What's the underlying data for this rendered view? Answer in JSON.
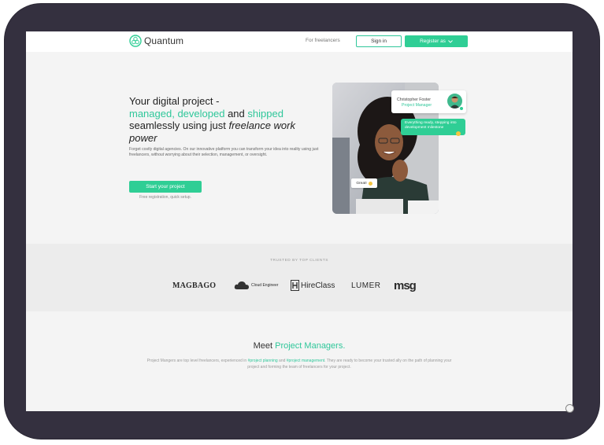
{
  "nav": {
    "brand": "Quantum",
    "for_freelancers": "For freelancers",
    "sign_in": "Sign in",
    "register": "Register as"
  },
  "hero": {
    "title_line1": "Your digital project -",
    "managed": "managed,",
    "developed": "developed",
    "and": "and",
    "shipped": "shipped",
    "line3": "seamlessly using just",
    "freelance": "freelance work power",
    "description": "Forget costly digital agencies. On our innovative platform you can transform your idea into reality using just freelancers, without worrying about their selection, management, or oversight.",
    "cta": "Start your project",
    "cta_note": "Free registration, quick setup."
  },
  "pm_card": {
    "name": "Christopher Foster",
    "role": "Project Manager",
    "message": "Everything ready, stepping into development milestone",
    "reply": "Great!"
  },
  "trusted": {
    "label": "TRUSTED BY TOP CLIENTS",
    "logos": [
      "MAGBAGO",
      "Cloud Engineer",
      "HireClass",
      "LUMER",
      "msg"
    ]
  },
  "meet": {
    "title_prefix": "Meet",
    "title_accent": "Project Managers.",
    "desc_part1": "Project Mangers are top level freelancers, experienced in",
    "tag1": "#project planning",
    "desc_and": "and",
    "tag2": "#project management",
    "desc_part2": ". They are ready to become your trusted ally on the path of planning your project and forming the team of freelancers for your project."
  },
  "colors": {
    "accent": "#2fce95",
    "frame": "#34303f"
  }
}
